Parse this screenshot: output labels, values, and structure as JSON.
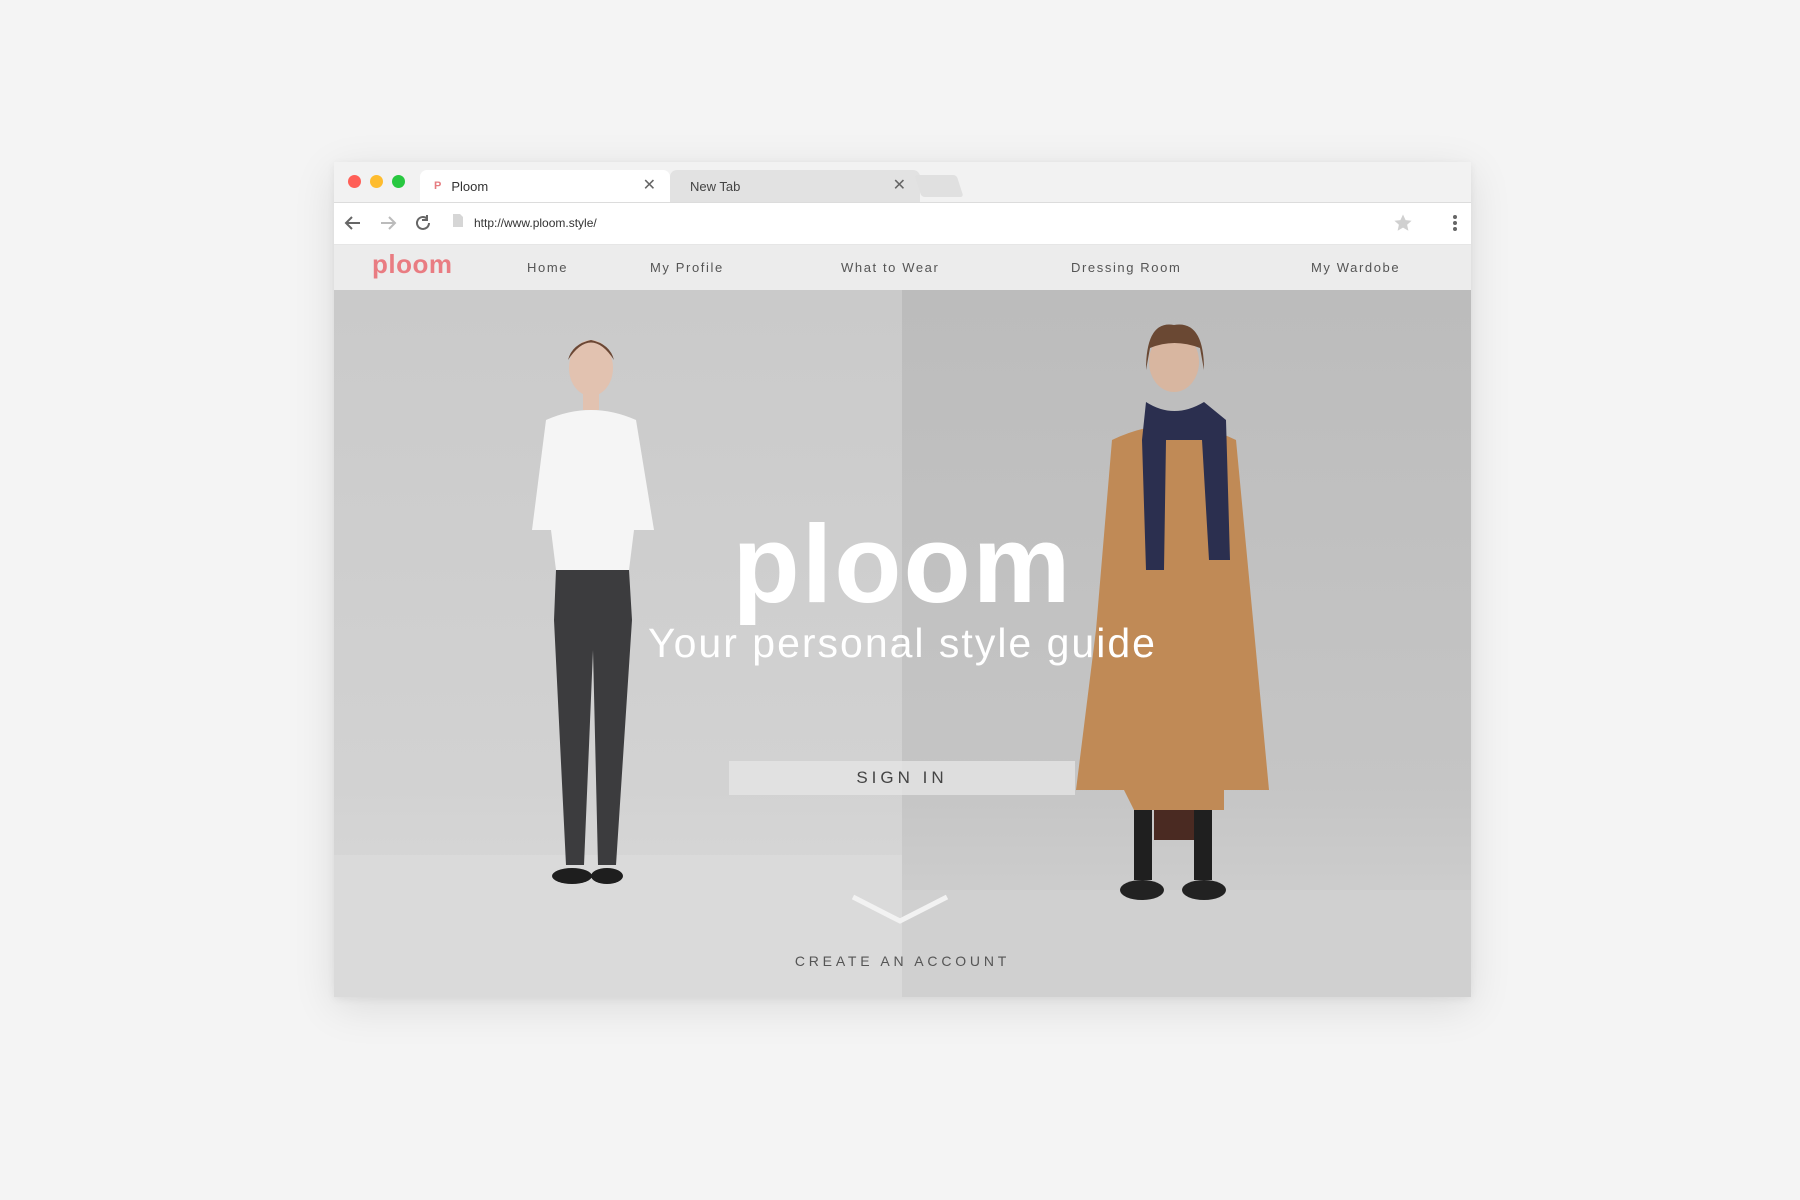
{
  "browser": {
    "tabs": [
      {
        "title": "Ploom",
        "favicon": "P"
      },
      {
        "title": "New Tab"
      }
    ],
    "url": "http://www.ploom.style/"
  },
  "site": {
    "logo": "ploom",
    "nav": [
      "Home",
      "My Profile",
      "What to Wear",
      "Dressing Room",
      "My Wardobe"
    ],
    "hero": {
      "brand": "ploom",
      "tagline": "Your personal style guide",
      "signin_label": "SIGN IN",
      "create_label": "CREATE AN ACCOUNT"
    }
  },
  "colors": {
    "brand": "#e97c82",
    "traffic_red": "#ff5f57",
    "traffic_yellow": "#febc2e",
    "traffic_green": "#28c840",
    "coat": "#c08a56",
    "scarf": "#2b2f4f"
  },
  "icons": [
    "back-arrow-icon",
    "forward-arrow-icon",
    "reload-icon",
    "page-icon",
    "star-icon",
    "menu-dots-icon",
    "close-icon",
    "chevron-down-icon"
  ]
}
